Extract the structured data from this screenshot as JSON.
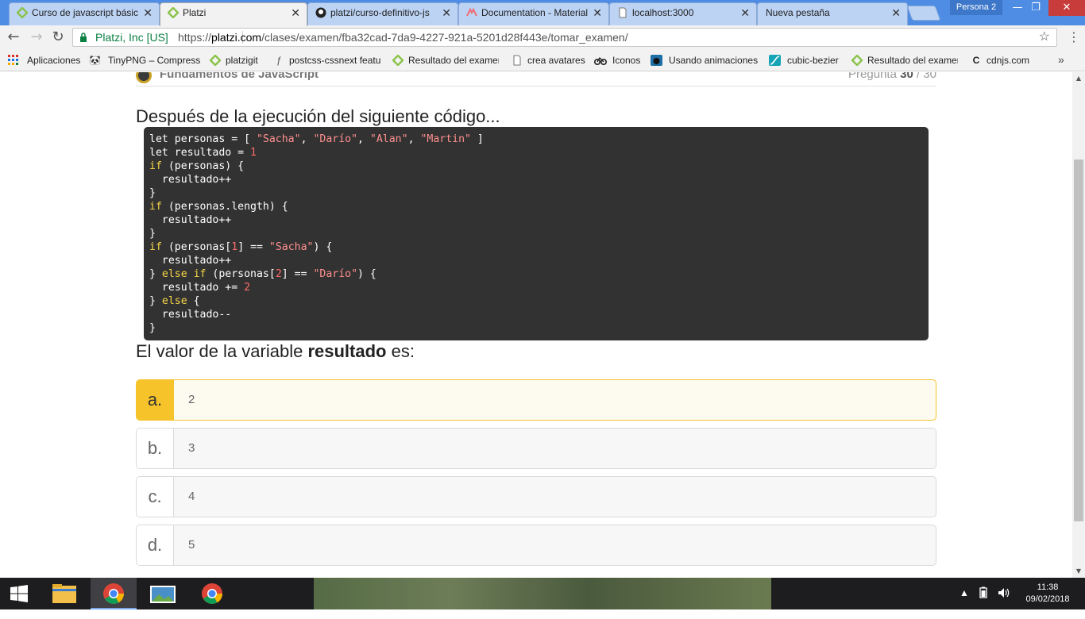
{
  "browser": {
    "tabs": [
      {
        "title": "Curso de javascript básico"
      },
      {
        "title": "Platzi"
      },
      {
        "title": "platzi/curso-definitivo-js"
      },
      {
        "title": "Documentation - Materialize"
      },
      {
        "title": "localhost:3000"
      },
      {
        "title": "Nueva pestaña"
      }
    ],
    "profile": "Persona 2",
    "minimize": "—",
    "maximize": "❐",
    "close": "✕",
    "secure_label": "Platzi, Inc [US]",
    "url_prefix": "https://",
    "url_host": "platzi.com",
    "url_path": "/clases/examen/fba32cad-7da9-4227-921a-5201d28f443e/tomar_examen/",
    "bookmarks": [
      {
        "label": "Aplicaciones",
        "icon": "apps-grid-icon"
      },
      {
        "label": "TinyPNG – Compress",
        "icon": "panda-icon"
      },
      {
        "label": "platzigit",
        "icon": "platzi-icon"
      },
      {
        "label": "postcss-cssnext featu",
        "icon": "postcss-icon"
      },
      {
        "label": "Resultado del examen",
        "icon": "platzi-icon"
      },
      {
        "label": "crea avatares",
        "icon": "page-icon"
      },
      {
        "label": "Iconos",
        "icon": "bike-icon"
      },
      {
        "label": "Usando animaciones",
        "icon": "bear-icon"
      },
      {
        "label": "cubic-bezier",
        "icon": "curve-icon"
      },
      {
        "label": "Resultado del examen",
        "icon": "platzi-icon"
      },
      {
        "label": "cdnjs.com",
        "icon": "cdnjs-icon"
      }
    ]
  },
  "exam": {
    "course_name": "Fundamentos de JavaScript",
    "question_label": "Pregunta",
    "question_current": "30",
    "question_total": "/ 30",
    "intro": "Después de la ejecución del siguiente código...",
    "code_lines": [
      [
        {
          "t": "let personas = [ ",
          "c": ""
        },
        {
          "t": "\"Sacha\"",
          "c": "str"
        },
        {
          "t": ", ",
          "c": ""
        },
        {
          "t": "\"Darío\"",
          "c": "str"
        },
        {
          "t": ", ",
          "c": ""
        },
        {
          "t": "\"Alan\"",
          "c": "str"
        },
        {
          "t": ", ",
          "c": ""
        },
        {
          "t": "\"Martin\"",
          "c": "str"
        },
        {
          "t": " ]",
          "c": ""
        }
      ],
      [
        {
          "t": "let resultado = ",
          "c": ""
        },
        {
          "t": "1",
          "c": "num"
        }
      ],
      [
        {
          "t": "if",
          "c": "kw"
        },
        {
          "t": " (personas) {",
          "c": ""
        }
      ],
      [
        {
          "t": "  resultado++",
          "c": ""
        }
      ],
      [
        {
          "t": "}",
          "c": ""
        }
      ],
      [
        {
          "t": "if",
          "c": "kw"
        },
        {
          "t": " (personas.length) {",
          "c": ""
        }
      ],
      [
        {
          "t": "  resultado++",
          "c": ""
        }
      ],
      [
        {
          "t": "}",
          "c": ""
        }
      ],
      [
        {
          "t": "if",
          "c": "kw"
        },
        {
          "t": " (personas[",
          "c": ""
        },
        {
          "t": "1",
          "c": "num"
        },
        {
          "t": "] == ",
          "c": ""
        },
        {
          "t": "\"Sacha\"",
          "c": "str"
        },
        {
          "t": ") {",
          "c": ""
        }
      ],
      [
        {
          "t": "  resultado++",
          "c": ""
        }
      ],
      [
        {
          "t": "} ",
          "c": ""
        },
        {
          "t": "else if",
          "c": "kw"
        },
        {
          "t": " (personas[",
          "c": ""
        },
        {
          "t": "2",
          "c": "num"
        },
        {
          "t": "] == ",
          "c": ""
        },
        {
          "t": "\"Darío\"",
          "c": "str"
        },
        {
          "t": ") {",
          "c": ""
        }
      ],
      [
        {
          "t": "  resultado += ",
          "c": ""
        },
        {
          "t": "2",
          "c": "num"
        }
      ],
      [
        {
          "t": "} ",
          "c": ""
        },
        {
          "t": "else",
          "c": "kw"
        },
        {
          "t": " {",
          "c": ""
        }
      ],
      [
        {
          "t": "  resultado--",
          "c": ""
        }
      ],
      [
        {
          "t": "}",
          "c": ""
        }
      ]
    ],
    "tail_before": "El valor de la variable ",
    "tail_bold": "resultado",
    "tail_after": " es:",
    "options": [
      {
        "letter": "a.",
        "value": "2",
        "selected": true
      },
      {
        "letter": "b.",
        "value": "3",
        "selected": false
      },
      {
        "letter": "c.",
        "value": "4",
        "selected": false
      },
      {
        "letter": "d.",
        "value": "5",
        "selected": false
      }
    ]
  },
  "taskbar": {
    "time": "11:38",
    "date": "09/02/2018"
  },
  "colors": {
    "accent_selected": "#f6c42a",
    "code_bg": "#323232",
    "tabstrip": "#4e8de3"
  }
}
